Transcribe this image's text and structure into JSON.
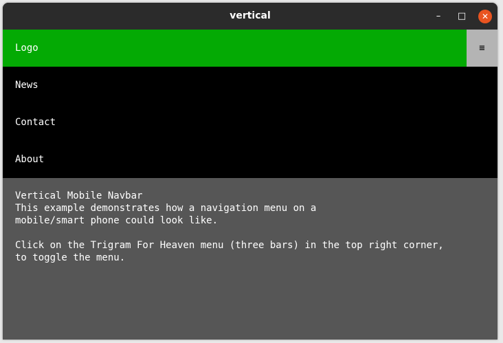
{
  "window": {
    "title": "vertical",
    "controls": {
      "minimize": "–",
      "maximize": "□",
      "close": "✕"
    }
  },
  "nav": {
    "logo": "Logo",
    "menu_icon": "≡",
    "links": [
      "News",
      "Contact",
      "About"
    ],
    "active_color": "#04aa04"
  },
  "content": {
    "heading": "Vertical Mobile Navbar",
    "para1_line1": "This example demonstrates how a navigation menu on a",
    "para1_line2": "mobile/smart phone could look like.",
    "para2_line1": "Click on the Trigram For Heaven menu (three bars) in the top right corner,",
    "para2_line2": "to toggle the menu."
  }
}
